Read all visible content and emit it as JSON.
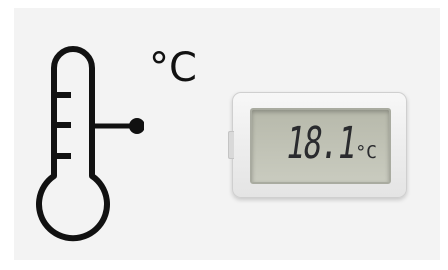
{
  "thermometer": {
    "unit_label": "°C"
  },
  "lcd_device": {
    "reading_value": "18.1",
    "reading_unit": "°C"
  },
  "colors": {
    "icon_stroke": "#111111",
    "panel_background": "#f3f3f3",
    "lcd_screen": "#c0c2b5",
    "lcd_digits": "#2a2b2e"
  }
}
